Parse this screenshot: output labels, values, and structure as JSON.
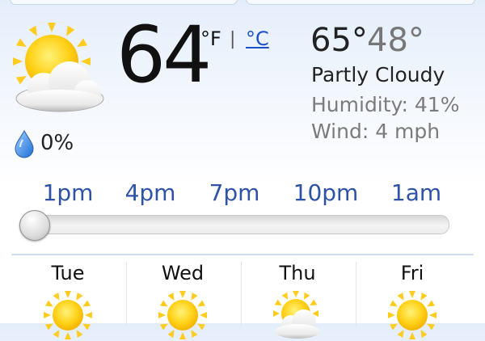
{
  "current": {
    "icon": "partly-cloudy-icon",
    "temperature": "64",
    "unit_f": "°F",
    "unit_separator": "|",
    "unit_c": "°C",
    "high": "65°",
    "low": "48°",
    "condition": "Partly Cloudy",
    "humidity": "Humidity: 41%",
    "wind": "Wind: 4 mph",
    "precip_icon": "raindrop-icon",
    "precip": "0%"
  },
  "timeline": {
    "hours": [
      "1pm",
      "4pm",
      "7pm",
      "10pm",
      "1am"
    ],
    "selected_index": 0,
    "slider_fraction": 0.0
  },
  "forecast": [
    {
      "day": "Tue",
      "icon": "sunny-icon"
    },
    {
      "day": "Wed",
      "icon": "sunny-icon"
    },
    {
      "day": "Thu",
      "icon": "partly-cloudy-icon"
    },
    {
      "day": "Fri",
      "icon": "sunny-icon"
    }
  ],
  "colors": {
    "link": "#1d4fc7",
    "hour_label": "#2d52a7",
    "secondary_text": "#7b7b7b",
    "sun": "#ffd21a"
  }
}
